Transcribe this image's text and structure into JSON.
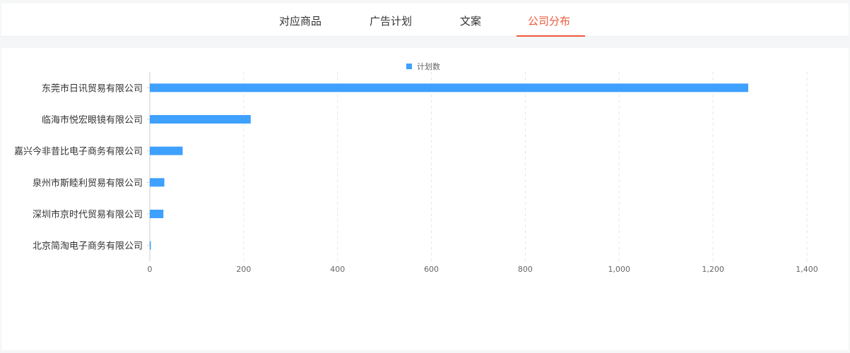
{
  "tabs": [
    {
      "label": "对应商品",
      "active": false
    },
    {
      "label": "广告计划",
      "active": false
    },
    {
      "label": "文案",
      "active": false
    },
    {
      "label": "公司分布",
      "active": true
    }
  ],
  "colors": {
    "accent": "#ee5a3c",
    "bar": "#3ea0ff",
    "axis_text": "#666666",
    "category_text": "#333333"
  },
  "chart_data": {
    "type": "bar",
    "orientation": "horizontal",
    "title": "",
    "xlabel": "",
    "ylabel": "",
    "legend": {
      "position": "top-center"
    },
    "grid": {
      "vertical_dashed": true
    },
    "categories": [
      "东莞市日讯贸易有限公司",
      "临海市悦宏眼镜有限公司",
      "嘉兴今非昔比电子商务有限公司",
      "泉州市斯睦利贸易有限公司",
      "深圳市京时代贸易有限公司",
      "北京简淘电子商务有限公司"
    ],
    "series": [
      {
        "name": "计划数",
        "values": [
          1275,
          215,
          70,
          31,
          29,
          2
        ]
      }
    ],
    "xlim": [
      0,
      1400
    ],
    "xticks": [
      0,
      200,
      400,
      600,
      800,
      1000,
      1200,
      1400
    ],
    "xtick_labels": [
      "0",
      "200",
      "400",
      "600",
      "800",
      "1,000",
      "1,200",
      "1,400"
    ]
  }
}
